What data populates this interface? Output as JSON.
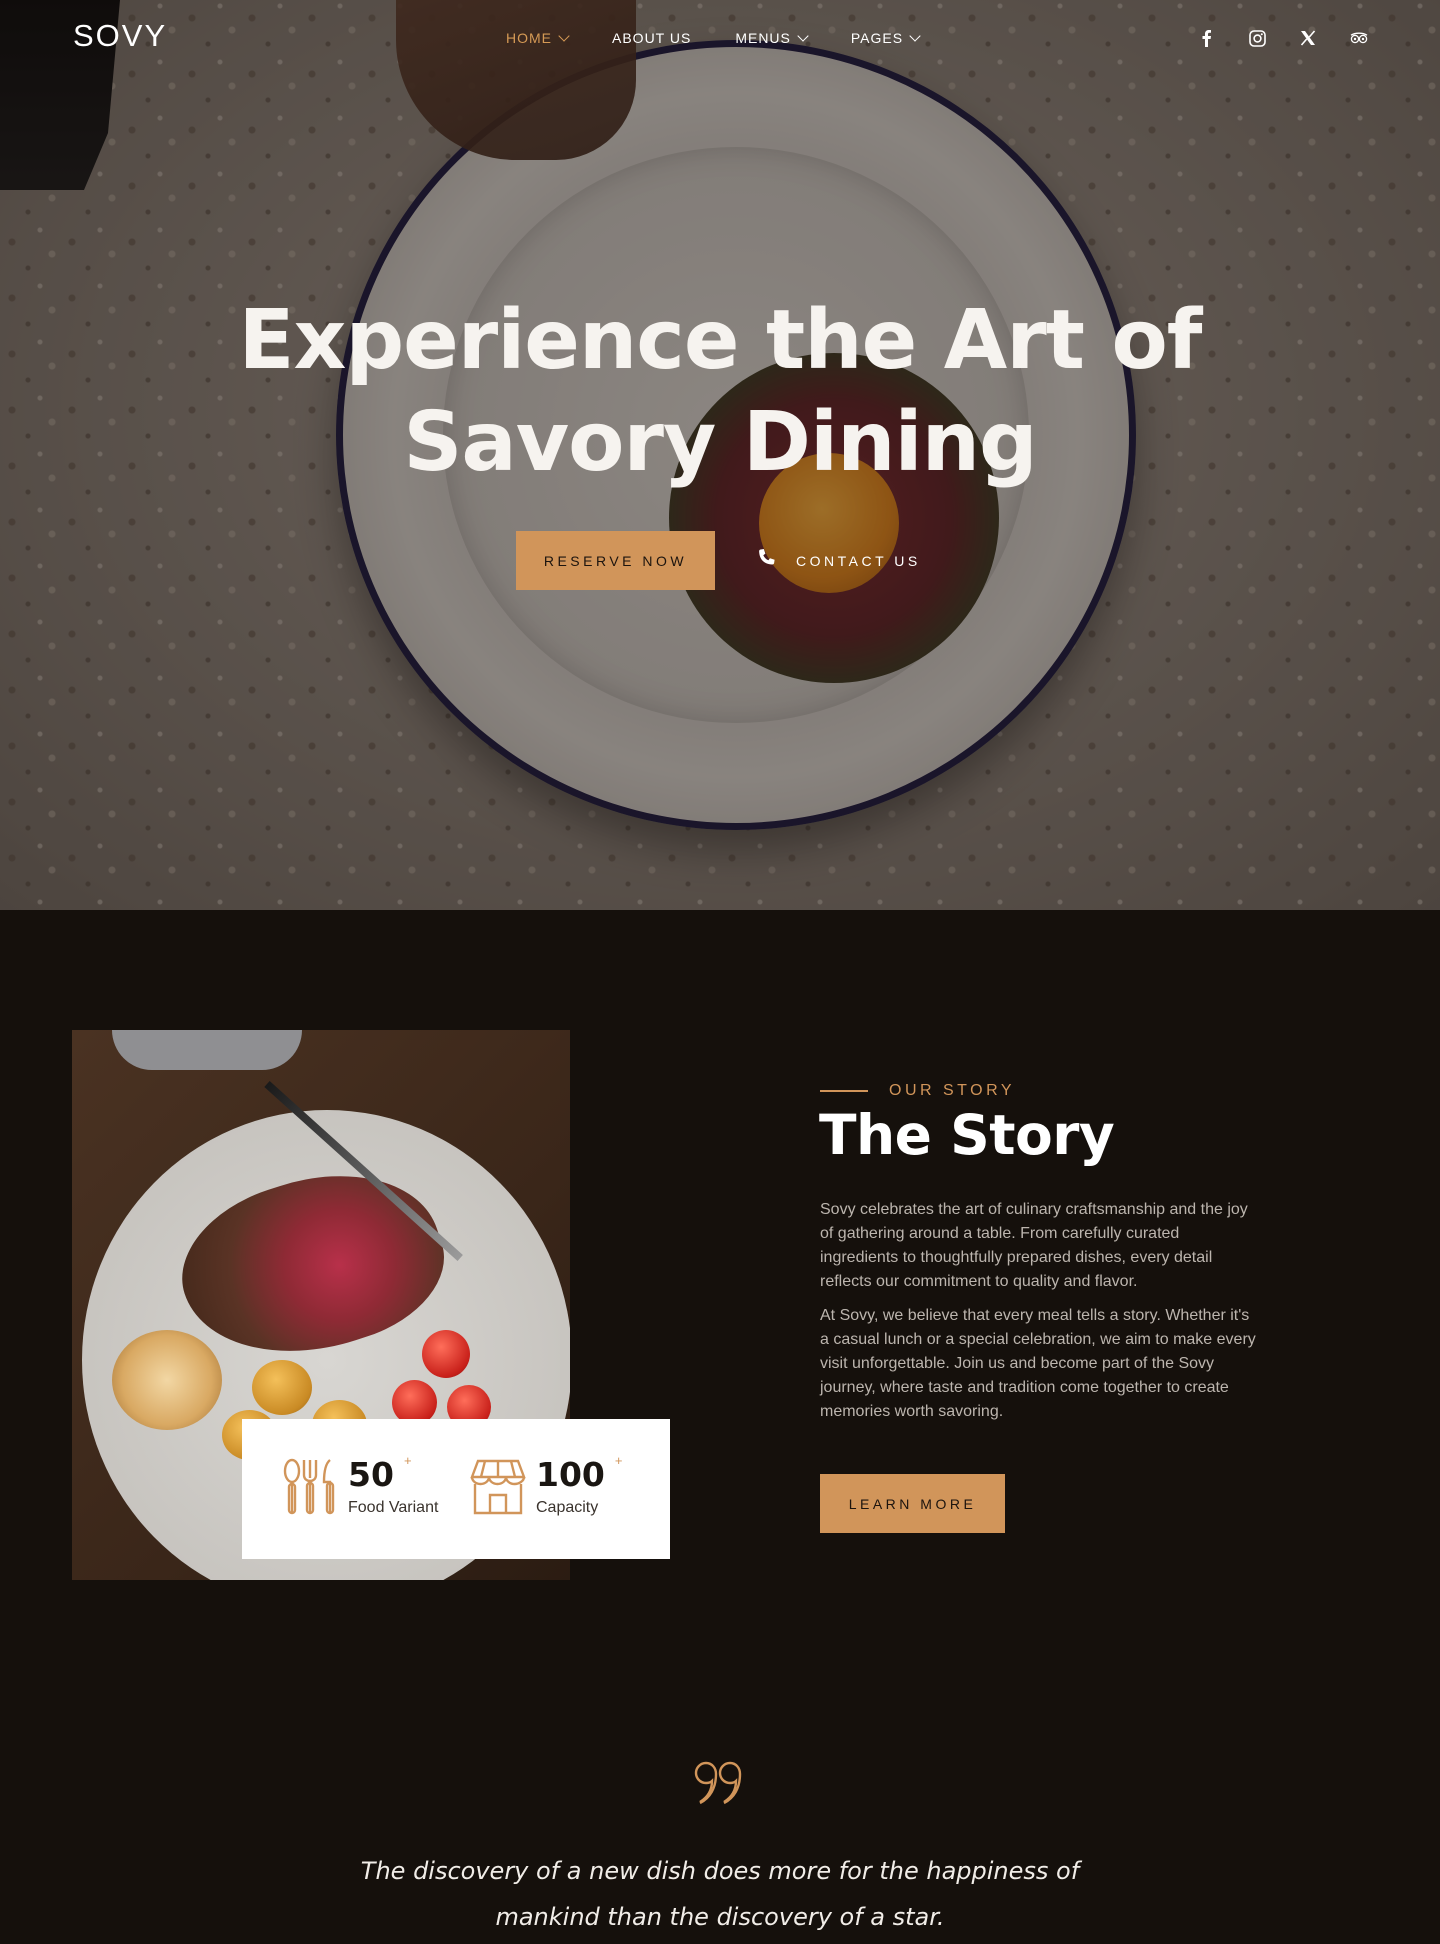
{
  "brand": {
    "logo": "SOVY",
    "accent": "#d1955a",
    "background": "#15100c"
  },
  "nav": {
    "items": [
      {
        "label": "HOME",
        "dropdown": true,
        "active": true
      },
      {
        "label": "ABOUT US",
        "dropdown": false,
        "active": false
      },
      {
        "label": "MENUS",
        "dropdown": true,
        "active": false
      },
      {
        "label": "PAGES",
        "dropdown": true,
        "active": false
      }
    ],
    "social": [
      "facebook-icon",
      "instagram-icon",
      "x-icon",
      "tripadvisor-icon"
    ]
  },
  "hero": {
    "title_line1": "Experience the Art of",
    "title_line2": "Savory Dining",
    "reserve_label": "RESERVE NOW",
    "contact_label": "CONTACT US",
    "contact_icon": "phone-icon"
  },
  "story": {
    "eyebrow": "OUR STORY",
    "title": "The Story",
    "paragraph1": "Sovy celebrates the art of culinary craftsmanship and the joy of gathering around a table. From carefully curated ingredients to thoughtfully prepared dishes, every detail reflects our commitment to quality and flavor.",
    "paragraph2": "At Sovy, we believe that every meal tells a story. Whether it's a casual lunch or a special celebration, we aim to make every visit unforgettable. Join us and become part of the Sovy journey, where taste and tradition come together to create memories worth savoring.",
    "cta_label": "LEARN MORE",
    "stats": [
      {
        "value": "50",
        "suffix": "+",
        "label": "Food Variant",
        "icon": "cutlery-icon"
      },
      {
        "value": "100",
        "suffix": "+",
        "label": "Capacity",
        "icon": "restaurant-icon"
      }
    ]
  },
  "quote": {
    "line1": "The discovery of a new dish does more for the happiness of",
    "line2": "mankind than the discovery of a star."
  }
}
